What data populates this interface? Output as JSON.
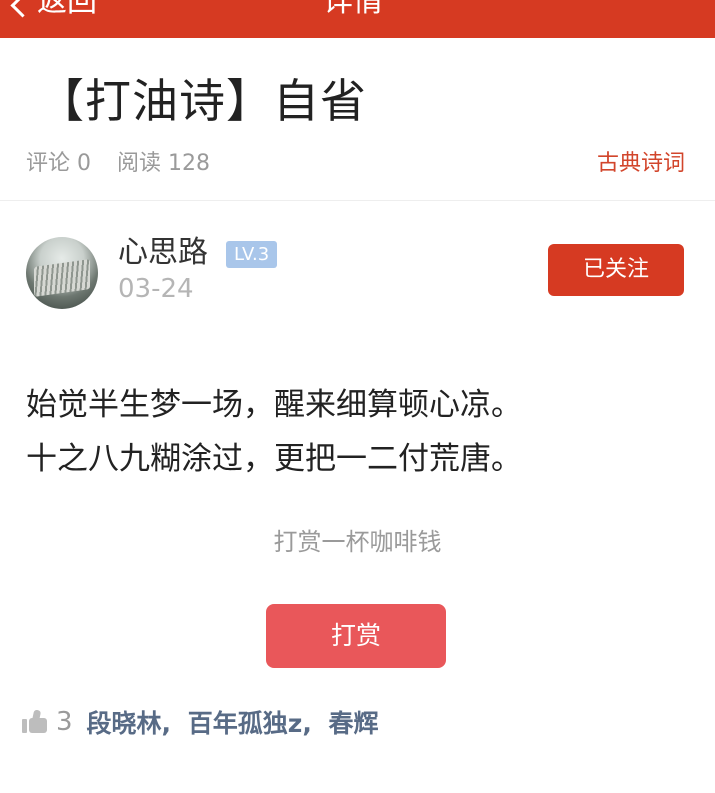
{
  "topbar": {
    "back_label": "返回",
    "title": "详情"
  },
  "article": {
    "title": "【打油诗】自省",
    "comments_label": "评论 0",
    "reads_label": "阅读 128",
    "category": "古典诗词"
  },
  "author": {
    "name": "心思路",
    "level": "LV.3",
    "date": "03-24",
    "follow_label": "已关注"
  },
  "poem": {
    "lines": [
      "始觉半生梦一场，醒来细算顿心凉。",
      "十之八九糊涂过，更把一二付荒唐。"
    ]
  },
  "reward": {
    "hint": "打赏一杯咖啡钱",
    "button_label": "打赏"
  },
  "likes": {
    "count": "3",
    "users": [
      "段晓林,",
      "百年孤独z,",
      "春辉"
    ]
  },
  "colors": {
    "brand_red": "#d63a22",
    "reward_red": "#e9575a",
    "level_blue": "#a9c6ea",
    "liker_blue": "#586b86"
  }
}
